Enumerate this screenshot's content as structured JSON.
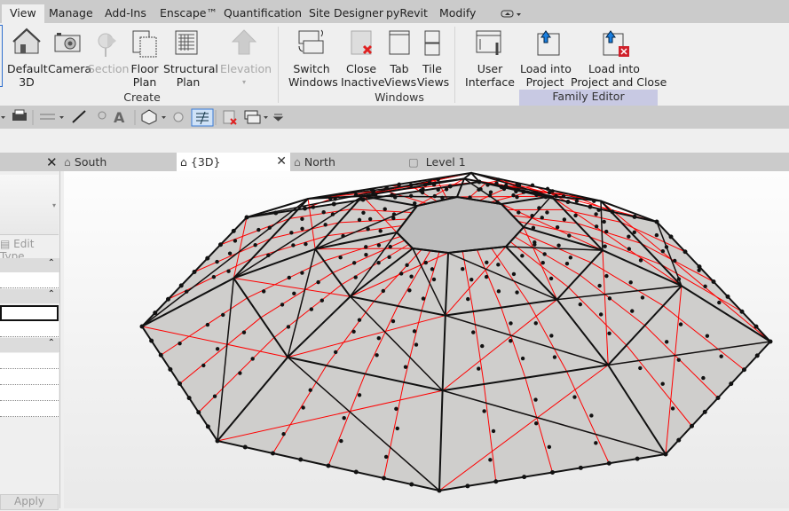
{
  "ribbon_tabs": [
    "View",
    "Manage",
    "Add-Ins",
    "Enscape™",
    "Quantification",
    "Site Designer",
    "pyRevit",
    "Modify"
  ],
  "create": {
    "label": "Create",
    "buttons": [
      "Default\n3D",
      "Camera",
      "Section",
      "Floor\nPlan",
      "Structural\nPlan",
      "Elevation"
    ]
  },
  "windows": {
    "label": "Windows",
    "buttons": [
      "Switch\nWindows",
      "Close\nInactive",
      "Tab\nViews",
      "Tile\nViews"
    ]
  },
  "family_editor": {
    "label": "Family Editor",
    "buttons": [
      "User\nInterface",
      "Load into\nProject",
      "Load into\nProject and Close"
    ]
  },
  "view_tabs": [
    "South",
    "{3D}",
    "North",
    "Level 1"
  ],
  "properties": {
    "edit_type": "Edit Type",
    "apply": "Apply"
  },
  "colors": {
    "accent": "#c8c9e3",
    "edge_red": "#ff0000"
  }
}
